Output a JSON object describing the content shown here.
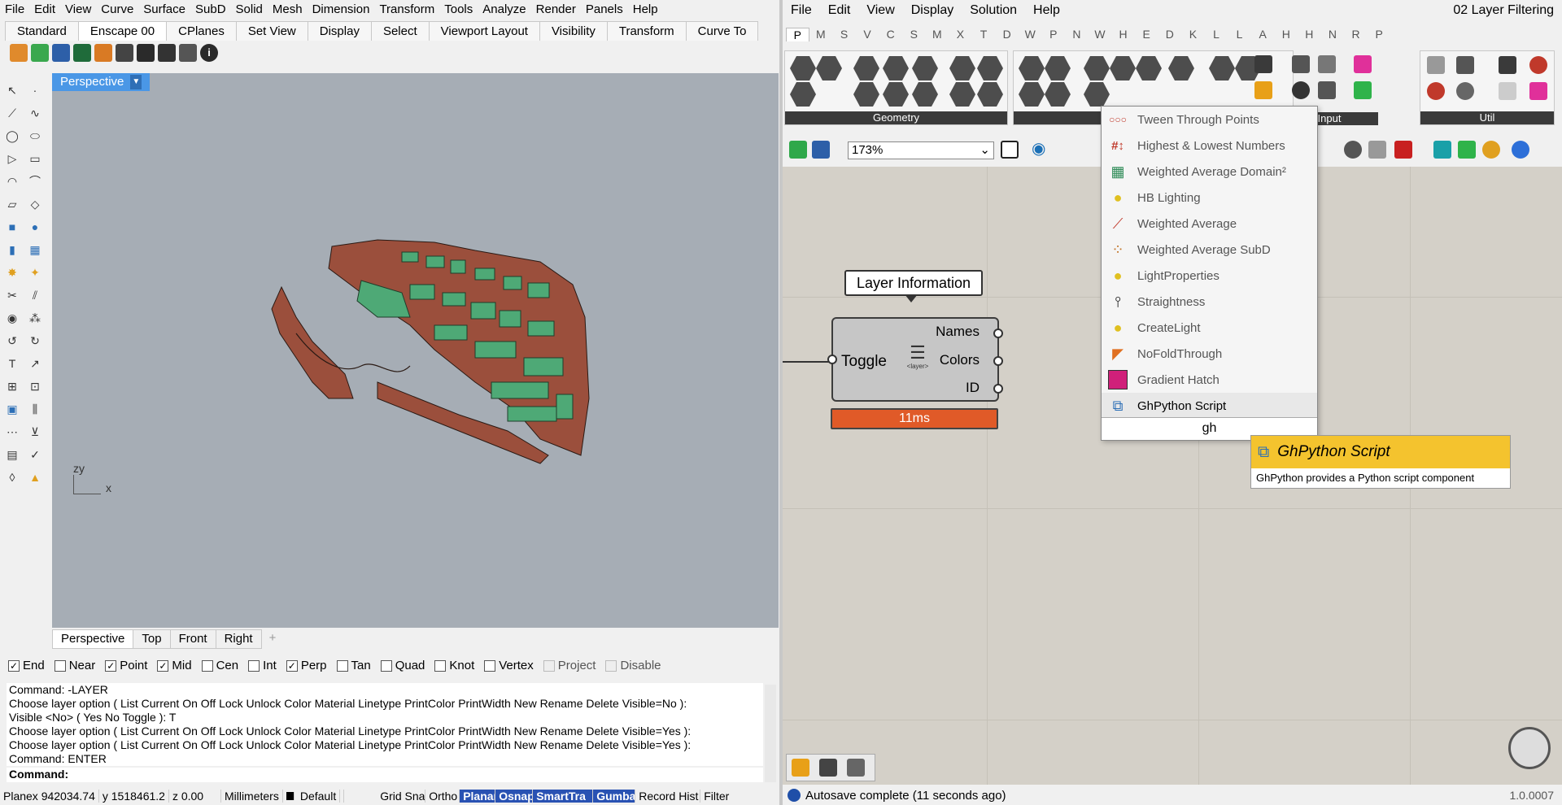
{
  "rhino": {
    "menu": [
      "File",
      "Edit",
      "View",
      "Curve",
      "Surface",
      "SubD",
      "Solid",
      "Mesh",
      "Dimension",
      "Transform",
      "Tools",
      "Analyze",
      "Render",
      "Panels",
      "Help"
    ],
    "tabs": [
      "Standard",
      "Enscape 00",
      "CPlanes",
      "Set View",
      "Display",
      "Select",
      "Viewport Layout",
      "Visibility",
      "Transform",
      "Curve To"
    ],
    "active_tab": "Enscape 00",
    "viewport_title": "Perspective",
    "axis_y": "y",
    "axis_z": "z",
    "axis_x": "x",
    "viewport_tabs": [
      "Perspective",
      "Top",
      "Front",
      "Right"
    ],
    "osnaps": [
      {
        "label": "End",
        "checked": true
      },
      {
        "label": "Near",
        "checked": false
      },
      {
        "label": "Point",
        "checked": true
      },
      {
        "label": "Mid",
        "checked": true
      },
      {
        "label": "Cen",
        "checked": false
      },
      {
        "label": "Int",
        "checked": false
      },
      {
        "label": "Perp",
        "checked": true
      },
      {
        "label": "Tan",
        "checked": false
      },
      {
        "label": "Quad",
        "checked": false
      },
      {
        "label": "Knot",
        "checked": false
      },
      {
        "label": "Vertex",
        "checked": false
      },
      {
        "label": "Project",
        "checked": false,
        "disabled": true
      },
      {
        "label": "Disable",
        "checked": false,
        "disabled": true
      }
    ],
    "command_history": [
      "Command: -LAYER",
      "Choose layer option ( List  Current  On  Off  Lock  Unlock  Color  Material  Linetype  PrintColor  PrintWidth  New  Rename  Delete  Visible=No ):",
      "Visible <No> ( Yes  No  Toggle ): T",
      "Choose layer option ( List  Current  On  Off  Lock  Unlock  Color  Material  Linetype  PrintColor  PrintWidth  New  Rename  Delete  Visible=Yes ):",
      "Choose layer option ( List  Current  On  Off  Lock  Unlock  Color  Material  Linetype  PrintColor  PrintWidth  New  Rename  Delete  Visible=Yes ):",
      "Command: ENTER"
    ],
    "command_prompt": "Command:",
    "status": {
      "cplane": "Planex 942034.74",
      "y": "y 1518461.2",
      "z": "z 0.00",
      "units": "Millimeters",
      "layer": "Default",
      "toggles": [
        {
          "label": "Grid Sna",
          "on": false
        },
        {
          "label": "Ortho",
          "on": false
        },
        {
          "label": "Planar",
          "on": true
        },
        {
          "label": "Osnap",
          "on": true
        },
        {
          "label": "SmartTra",
          "on": true
        },
        {
          "label": "Gumba",
          "on": true
        },
        {
          "label": "Record Hist",
          "on": false
        },
        {
          "label": "Filter",
          "on": false
        }
      ]
    }
  },
  "gh": {
    "menu": [
      "File",
      "Edit",
      "View",
      "Display",
      "Solution",
      "Help"
    ],
    "document_title": "02 Layer Filtering",
    "tabs": [
      "P",
      "M",
      "S",
      "V",
      "C",
      "S",
      "M",
      "X",
      "T",
      "D",
      "W",
      "P",
      "N",
      "W",
      "H",
      "E",
      "D",
      "K",
      "L",
      "L",
      "A",
      "H",
      "H",
      "N",
      "R",
      "P"
    ],
    "active_tab_index": 0,
    "panels": [
      "Geometry",
      "Input",
      "Util"
    ],
    "zoom": "173%",
    "component": {
      "bubble": "Layer Information",
      "input": "Toggle",
      "outputs": [
        "Names",
        "Colors",
        "ID"
      ],
      "icon_text": "<layer>",
      "timer": "11ms"
    },
    "search_results": [
      {
        "label": "Tween Through Points",
        "icon": "tween-icon"
      },
      {
        "label": "Highest & Lowest Numbers",
        "icon": "number-icon"
      },
      {
        "label": "Weighted Average Domain²",
        "icon": "domain-icon"
      },
      {
        "label": "HB Lighting",
        "icon": "bulb-icon"
      },
      {
        "label": "Weighted Average",
        "icon": "average-icon"
      },
      {
        "label": "Weighted Average SubD",
        "icon": "subd-icon"
      },
      {
        "label": "LightProperties",
        "icon": "bulb-icon"
      },
      {
        "label": "Straightness",
        "icon": "straight-icon"
      },
      {
        "label": "CreateLight",
        "icon": "bulb-icon"
      },
      {
        "label": "NoFoldThrough",
        "icon": "fold-icon"
      },
      {
        "label": "Gradient Hatch",
        "icon": "hatch-icon"
      },
      {
        "label": "GhPython Script",
        "icon": "python-icon"
      }
    ],
    "search_query": "gh",
    "tooltip": {
      "title": "GhPython Script",
      "description": "GhPython provides a Python script component"
    },
    "autosave": "Autosave complete (11 seconds ago)",
    "version": "1.0.0007",
    "colors": {
      "accent": "#4a97e6",
      "timer": "#e05a28",
      "tooltip": "#f4c32e",
      "roads": "#9b4f3c",
      "buildings": "#4ea976"
    }
  }
}
